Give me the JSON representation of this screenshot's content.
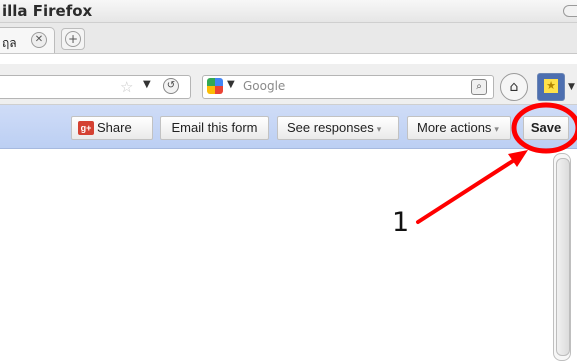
{
  "window": {
    "title": "illa Firefox"
  },
  "tab": {
    "label": "ฤล",
    "close_glyph": "✕",
    "new_tab_glyph": "+"
  },
  "navbar": {
    "search_placeholder": "Google",
    "star_glyph": "☆",
    "dropdown_glyph": "▼",
    "reload_glyph": "↺",
    "magnifier_glyph": "⌕",
    "home_glyph": "⌂",
    "bookmark_glyph": "★"
  },
  "toolbar": {
    "share_label": "Share",
    "gplus_label": "g+",
    "email_label": "Email this form",
    "responses_label": "See responses",
    "more_label": "More actions",
    "save_label": "Save",
    "caret_glyph": "▾"
  },
  "annotation": {
    "number": "1",
    "color": "#ff0000"
  },
  "colors": {
    "toolbar_bg": "#c6d6f5",
    "gplus": "#d44132",
    "annotation": "#ff0000"
  }
}
